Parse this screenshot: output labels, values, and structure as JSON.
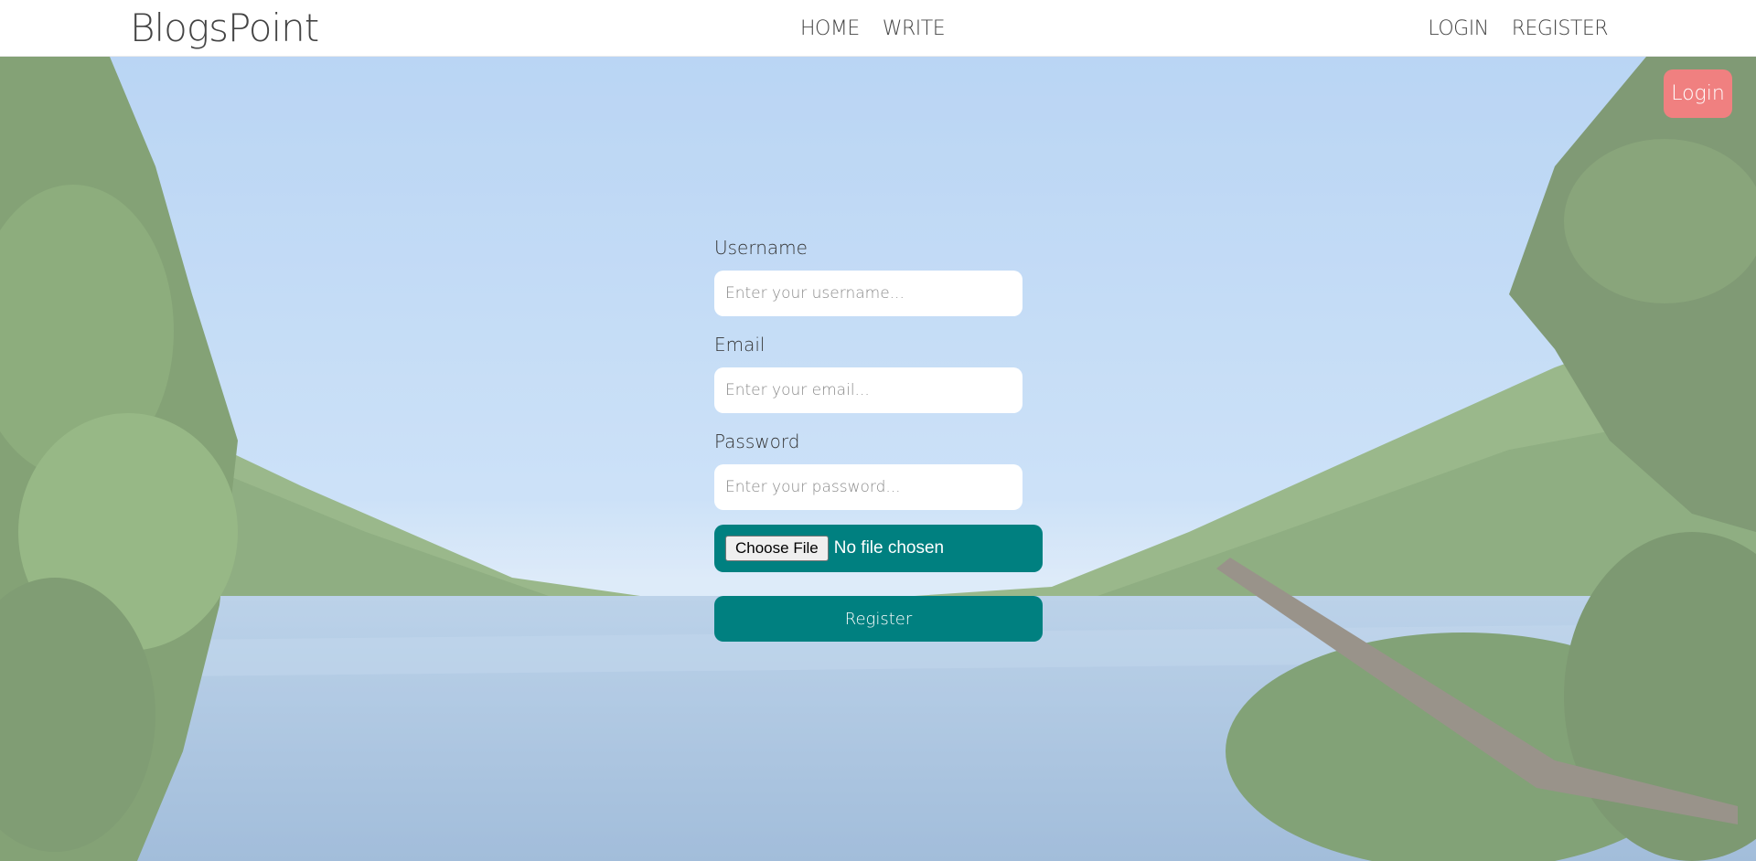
{
  "navbar": {
    "brand": "BlogsPoint",
    "center_links": [
      "HOME",
      "WRITE"
    ],
    "right_links": [
      "LOGIN",
      "REGISTER"
    ]
  },
  "floating_button": {
    "label": "Login",
    "color": "#f08080"
  },
  "form": {
    "username": {
      "label": "Username",
      "placeholder": "Enter your username..."
    },
    "email": {
      "label": "Email",
      "placeholder": "Enter your email..."
    },
    "password": {
      "label": "Password",
      "placeholder": "Enter your password..."
    },
    "file": {
      "button_label": "Choose File",
      "status": "No file chosen"
    },
    "submit_label": "Register"
  },
  "colors": {
    "accent": "#008080",
    "login_button": "#f08080"
  }
}
